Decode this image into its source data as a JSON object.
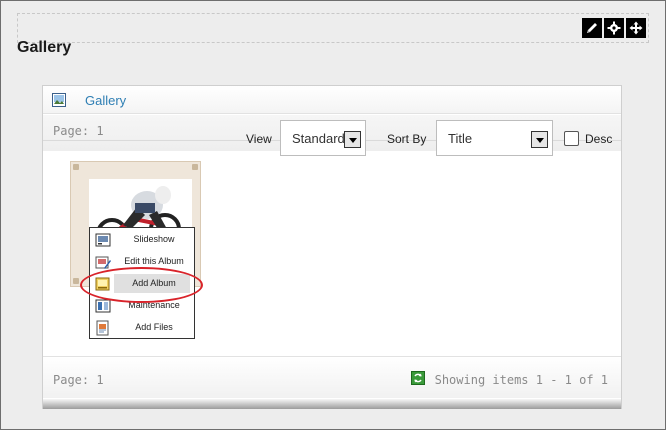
{
  "page": {
    "title": "Gallery"
  },
  "tools": [
    {
      "icon": "pencil-icon",
      "name": "edit"
    },
    {
      "icon": "gear-icon",
      "name": "settings"
    },
    {
      "icon": "move-arrows-icon",
      "name": "move"
    }
  ],
  "module": {
    "title": "Gallery",
    "header_icon": "image-icon",
    "toolbar": {
      "page_label": "Page: 1",
      "view_label": "View",
      "view_value": "Standard",
      "sort_label": "Sort By",
      "sort_value": "Title",
      "desc_label": "Desc",
      "desc_checked": false
    },
    "context_menu": {
      "items": [
        {
          "label": "Slideshow",
          "icon": "slideshow-icon"
        },
        {
          "label": "Edit this Album",
          "icon": "edit-album-icon"
        },
        {
          "label": "Add Album",
          "icon": "add-album-icon",
          "highlighted": true
        },
        {
          "label": "Maintenance",
          "icon": "maintenance-icon"
        },
        {
          "label": "Add Files",
          "icon": "add-files-icon"
        }
      ],
      "annotation_color": "#d9232a"
    },
    "footer": {
      "page_label": "Page: 1",
      "refresh_icon": "refresh-icon",
      "items_label": "Showing items 1 - 1 of 1"
    }
  },
  "colors": {
    "link": "#2f7fb4",
    "frame": "#ededed"
  }
}
